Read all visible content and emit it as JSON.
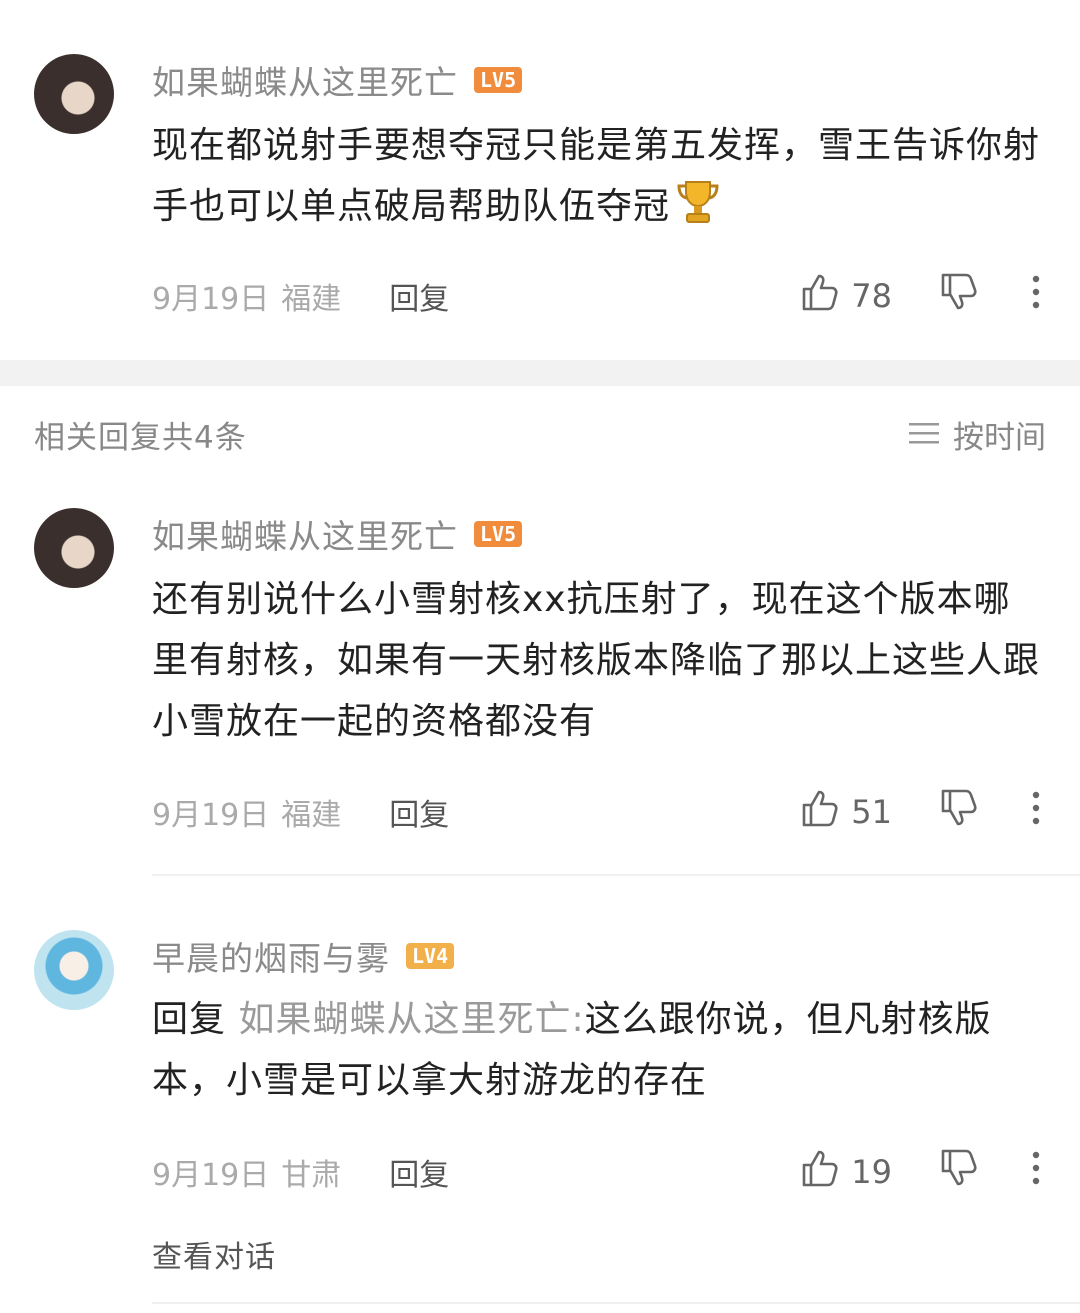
{
  "comments": [
    {
      "username": "如果蝴蝶从这里死亡",
      "level": "LV5",
      "text": "现在都说射手要想夺冠只能是第五发挥，雪王告诉你射手也可以单点破局帮助队伍夺冠",
      "date": "9月19日",
      "location": "福建",
      "reply_label": "回复",
      "likes": "78"
    }
  ],
  "section": {
    "title": "相关回复共4条",
    "sort_label": "按时间"
  },
  "replies": [
    {
      "username": "如果蝴蝶从这里死亡",
      "level": "LV5",
      "text": "还有别说什么小雪射核xx抗压射了，现在这个版本哪里有射核，如果有一天射核版本降临了那以上这些人跟小雪放在一起的资格都没有",
      "date": "9月19日",
      "location": "福建",
      "reply_label": "回复",
      "likes": "51"
    },
    {
      "username": "早晨的烟雨与雾",
      "level": "LV4",
      "reply_prefix": "回复",
      "reply_target": "如果蝴蝶从这里死亡:",
      "text": "这么跟你说，但凡射核版本，小雪是可以拿大射游龙的存在",
      "date": "9月19日",
      "location": "甘肃",
      "reply_label": "回复",
      "likes": "19"
    }
  ],
  "view_conversation": "查看对话",
  "icons": {
    "like": "thumbs-up-icon",
    "dislike": "thumbs-down-icon",
    "more": "more-vertical-icon",
    "sort": "list-icon",
    "trophy": "trophy-icon"
  },
  "colors": {
    "level5": "#f08c3c",
    "level4": "#f2b04a",
    "muted": "#aaaaaa"
  }
}
